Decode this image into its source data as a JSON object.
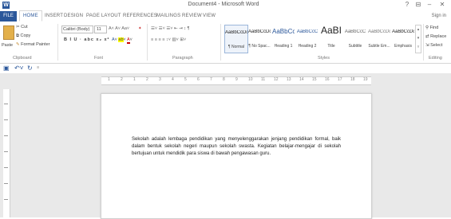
{
  "window": {
    "title": "Document4 - Microsoft Word",
    "help": "?",
    "restore": "⊟",
    "minimize": "–",
    "close": "✕",
    "signin": "Sign in"
  },
  "tabs": [
    "FILE",
    "HOME",
    "INSERT",
    "DESIGN",
    "PAGE LAYOUT",
    "REFERENCES",
    "MAILINGS",
    "REVIEW",
    "VIEW"
  ],
  "clipboard": {
    "paste": "Paste",
    "cut": "Cut",
    "copy": "Copy",
    "format_painter": "Format Painter",
    "label": "Clipboard"
  },
  "font": {
    "name": "Calibri (Body)",
    "size": "11",
    "label": "Font",
    "row2": "B  I  U  ·  abc  x₂  x²"
  },
  "paragraph": {
    "label": "Paragraph"
  },
  "styles": {
    "items": [
      {
        "sample": "AaBbCcDc",
        "name": "¶ Normal"
      },
      {
        "sample": "AaBbCcDc",
        "name": "¶ No Spac..."
      },
      {
        "sample": "AaBbCc",
        "name": "Heading 1"
      },
      {
        "sample": "AaBbCcC",
        "name": "Heading 2"
      },
      {
        "sample": "AaBI",
        "name": "Title"
      },
      {
        "sample": "AaBbCcC",
        "name": "Subtitle"
      },
      {
        "sample": "AaBbCcDc",
        "name": "Subtle Em..."
      },
      {
        "sample": "AaBbCcDc",
        "name": "Emphasis"
      }
    ],
    "label": "Styles"
  },
  "editing": {
    "find": "Find",
    "replace": "Replace",
    "select": "Select",
    "label": "Editing"
  },
  "ruler_ticks": [
    "1",
    "2",
    "1",
    "2",
    "3",
    "4",
    "5",
    "6",
    "7",
    "8",
    "9",
    "10",
    "11",
    "12",
    "13",
    "14",
    "15",
    "16",
    "17",
    "18",
    "19"
  ],
  "document": {
    "text": "Sekolah adalah lembaga pendidikan yang menyelenggarakan jenjang pendidikan formal, baik dalam bentuk sekolah negeri maupun sekolah swasta. Kegiatan belajar-mengajar di sekolah bertujuan untuk mendidik para siswa di bawah pengawasan guru."
  },
  "colors": {
    "accent": "#2b579a",
    "background": "#e9e9e9"
  }
}
